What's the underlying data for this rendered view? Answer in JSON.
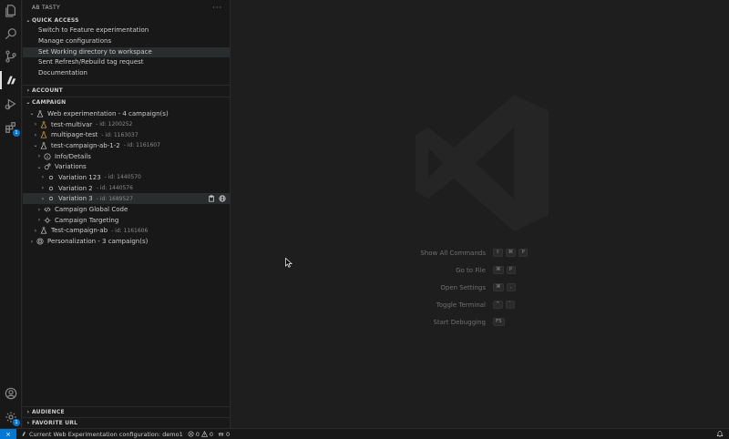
{
  "activity_bar": {
    "icons": [
      "files-icon",
      "search-icon",
      "source-control-icon",
      "ab-tasty-icon",
      "run-debug-icon",
      "extensions-icon",
      "account-icon",
      "settings-gear-icon"
    ],
    "extensions_badge": "1",
    "settings_badge": "1"
  },
  "sidebar": {
    "title": "AB TASTY",
    "more": "···",
    "quick_access": {
      "title": "QUICK ACCESS",
      "items": [
        "Switch to Feature experimentation",
        "Manage configurations",
        "Set Working directory to workspace",
        "Sent Refresh/Rebuild tag request",
        "Documentation"
      ]
    },
    "account": {
      "title": "ACCOUNT"
    },
    "campaign": {
      "title": "CAMPAIGN",
      "web_experimentation": "Web experimentation - 4 campaign(s)",
      "campaigns": [
        {
          "label": "test-multivar",
          "desc": "- id: 1200252"
        },
        {
          "label": "multipage-test",
          "desc": "- id: 1163037"
        },
        {
          "label": "test-campaign-ab-1-2",
          "desc": "- id: 1161607"
        }
      ],
      "info_details": "Info/Details",
      "variations": "Variations",
      "variation_items": [
        {
          "label": "Variation 123",
          "desc": "- id: 1440570"
        },
        {
          "label": "Variation 2",
          "desc": "- id: 1440576"
        },
        {
          "label": "Variation 3",
          "desc": "- id: 1689527"
        }
      ],
      "global_code": "Campaign Global Code",
      "targeting": "Campaign Targeting",
      "test_campaign_ab": {
        "label": "Test-campaign-ab",
        "desc": "- id: 1161606"
      },
      "personalization": "Personalization - 3 campaign(s)"
    },
    "audience": {
      "title": "AUDIENCE"
    },
    "favorite_url": {
      "title": "FAVORITE URL"
    }
  },
  "editor": {
    "shortcuts": [
      {
        "label": "Show All Commands",
        "keys": [
          "⇧",
          "⌘",
          "P"
        ]
      },
      {
        "label": "Go to File",
        "keys": [
          "⌘",
          "P"
        ]
      },
      {
        "label": "Open Settings",
        "keys": [
          "⌘",
          ","
        ]
      },
      {
        "label": "Toggle Terminal",
        "keys": [
          "^",
          "`"
        ]
      },
      {
        "label": "Start Debugging",
        "keys": [
          "F5"
        ]
      }
    ]
  },
  "status_bar": {
    "remote": "⨯",
    "config": "Current Web Experimentation configuration: demo1",
    "errors": "0",
    "warnings": "0",
    "ports": "0"
  },
  "colors": {
    "accent": "#0078d4",
    "beaker": "#e2a93b",
    "background": "#1e1e1e",
    "sidebar": "#181818"
  }
}
